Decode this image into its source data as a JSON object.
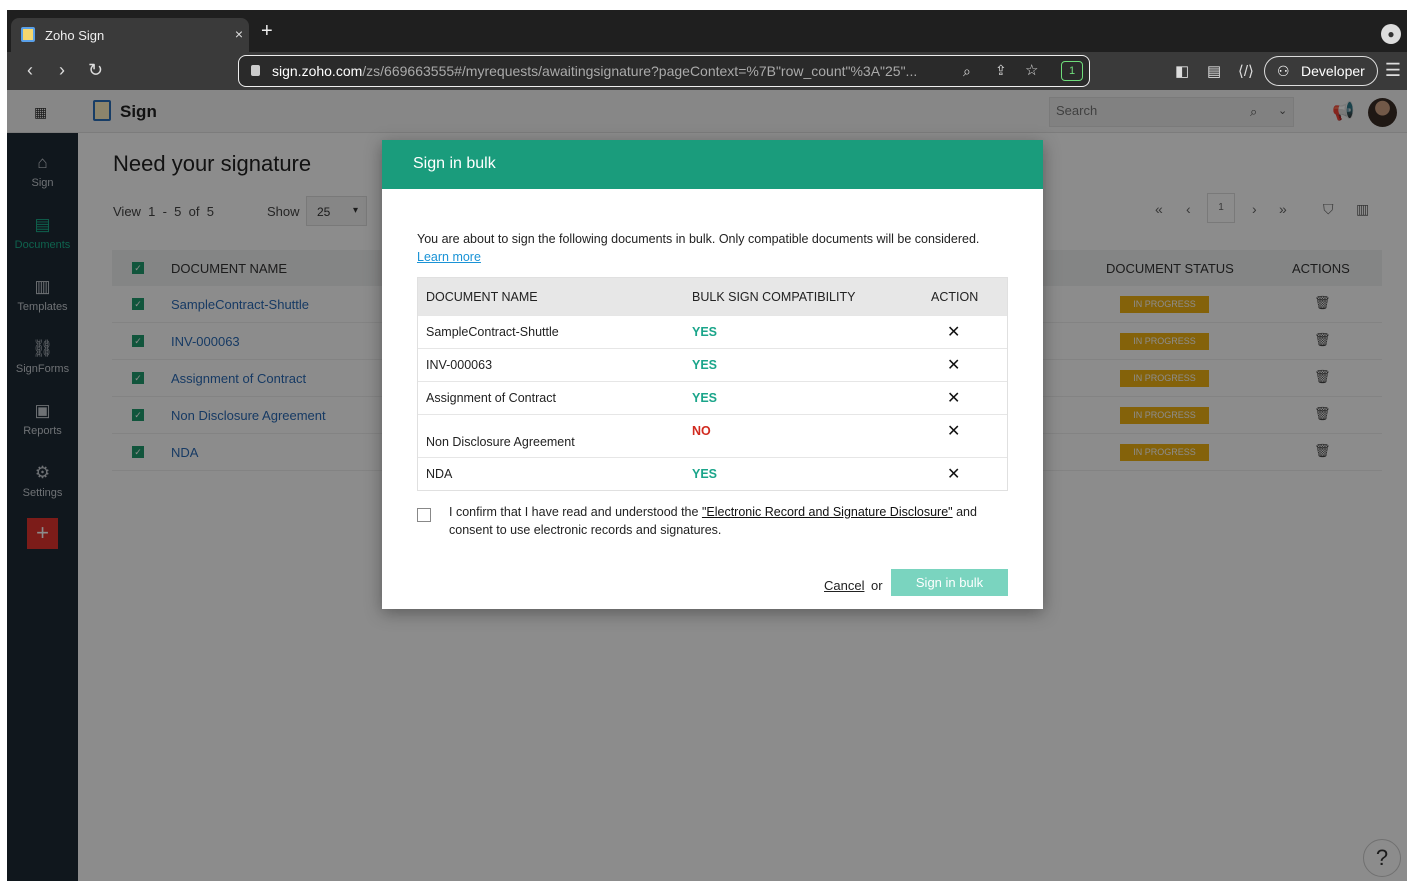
{
  "browser": {
    "tab_title": "Zoho Sign",
    "tab_close": "×",
    "new_tab": "+",
    "back": "‹",
    "forward": "›",
    "reload": "↻",
    "url_host": "sign.zoho.com",
    "url_path": "/zs/669663555#/myrequests/awaitingsignature?pageContext=%7B\"row_count\"%3A\"25\"...",
    "developer_label": "Developer",
    "extension_badge": "1"
  },
  "app": {
    "name": "Sign",
    "search_placeholder": "Search"
  },
  "sidebar": {
    "items": [
      {
        "label": "Sign",
        "icon": "home-icon"
      },
      {
        "label": "Documents",
        "icon": "documents-icon"
      },
      {
        "label": "Templates",
        "icon": "templates-icon"
      },
      {
        "label": "SignForms",
        "icon": "link-icon"
      },
      {
        "label": "Reports",
        "icon": "reports-icon"
      },
      {
        "label": "Settings",
        "icon": "gear-icon"
      }
    ],
    "add_label": "+"
  },
  "page": {
    "title": "Need your signature",
    "view_info": "View  1  -  5  of  5",
    "show_label": "Show",
    "show_value": "25",
    "current_page": "1",
    "columns": {
      "document_name": "DOCUMENT NAME",
      "document_status": "DOCUMENT STATUS",
      "actions": "ACTIONS"
    },
    "rows": [
      {
        "name": "SampleContract-Shuttle",
        "status": "IN PROGRESS"
      },
      {
        "name": "INV-000063",
        "status": "IN PROGRESS"
      },
      {
        "name": "Assignment of Contract",
        "status": "IN PROGRESS"
      },
      {
        "name": "Non Disclosure Agreement",
        "status": "IN PROGRESS"
      },
      {
        "name": "NDA",
        "status": "IN PROGRESS"
      }
    ],
    "help_label": "?"
  },
  "modal": {
    "title": "Sign in bulk",
    "intro": "You are about to sign the following documents in bulk. Only compatible documents will be considered. ",
    "learn_more": "Learn more",
    "columns": {
      "document_name": "DOCUMENT NAME",
      "compatibility": "BULK SIGN COMPATIBILITY",
      "action": "ACTION"
    },
    "rows": [
      {
        "name": "SampleContract-Shuttle",
        "compatibility": "YES"
      },
      {
        "name": "INV-000063",
        "compatibility": "YES"
      },
      {
        "name": "Assignment of Contract",
        "compatibility": "YES"
      },
      {
        "name": "Non Disclosure Agreement",
        "compatibility": "NO"
      },
      {
        "name": "NDA",
        "compatibility": "YES"
      }
    ],
    "remove_glyph": "✕",
    "confirm_pre": "I confirm that I have read and understood the ",
    "confirm_link": "\"Electronic Record and Signature Disclosure\"",
    "confirm_post": " and consent to use electronic records and signatures.",
    "cancel_label": "Cancel",
    "or_label": "or",
    "submit_label": "Sign in bulk"
  },
  "colors": {
    "accent": "#1a9c7c",
    "yes": "#1aa58a",
    "no": "#d12a1f",
    "status_badge": "#f1b313",
    "sidebar_bg": "#1e2a36"
  }
}
